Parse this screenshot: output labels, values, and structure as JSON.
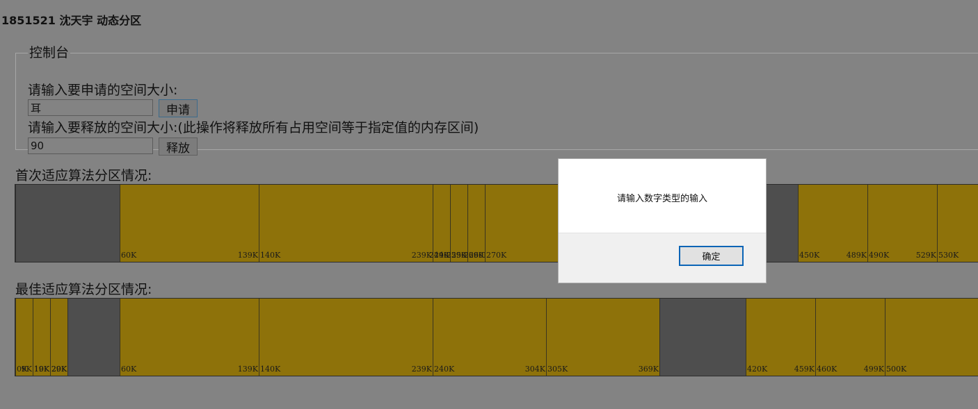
{
  "page": {
    "title": "1851521 沈天宇 动态分区"
  },
  "console": {
    "legend": "控制台",
    "apply_label": "请输入要申请的空间大小:",
    "apply_value": "耳",
    "apply_button": "申请",
    "release_label": "请输入要释放的空间大小:(此操作将释放所有占用空间等于指定值的内存区间)",
    "release_value": "90",
    "release_button": "释放"
  },
  "first_fit": {
    "title": "首次适应算法分区情况:",
    "blocks": [
      {
        "status": "free",
        "start": "",
        "end": ""
      },
      {
        "status": "used",
        "start": "60K",
        "end": "139K"
      },
      {
        "status": "used",
        "start": "140K",
        "end": "239K"
      },
      {
        "status": "used",
        "start": "240K",
        "end": "249K"
      },
      {
        "status": "used",
        "start": "250K",
        "end": "259K"
      },
      {
        "status": "used",
        "start": "260K",
        "end": "269K"
      },
      {
        "status": "used",
        "start": "270K",
        "end": ""
      },
      {
        "status": "free",
        "start": "",
        "end": ""
      },
      {
        "status": "used",
        "start": "450K",
        "end": "489K"
      },
      {
        "status": "used",
        "start": "490K",
        "end": "529K"
      },
      {
        "status": "used",
        "start": "530K",
        "end": ""
      }
    ]
  },
  "best_fit": {
    "title": "最佳适应算法分区情况:",
    "blocks": [
      {
        "status": "used",
        "start": "0K",
        "end": "9K"
      },
      {
        "status": "used",
        "start": "10K",
        "end": "19K"
      },
      {
        "status": "used",
        "start": "20K",
        "end": "29K"
      },
      {
        "status": "free",
        "start": "",
        "end": ""
      },
      {
        "status": "used",
        "start": "60K",
        "end": "139K"
      },
      {
        "status": "used",
        "start": "140K",
        "end": "239K"
      },
      {
        "status": "used",
        "start": "240K",
        "end": "304K"
      },
      {
        "status": "used",
        "start": "305K",
        "end": "369K"
      },
      {
        "status": "free",
        "start": "",
        "end": ""
      },
      {
        "status": "used",
        "start": "420K",
        "end": "459K"
      },
      {
        "status": "used",
        "start": "460K",
        "end": "499K"
      },
      {
        "status": "used",
        "start": "500K",
        "end": ""
      }
    ]
  },
  "dialog": {
    "message": "请输入数字类型的输入",
    "ok_button": "确定"
  },
  "colors": {
    "background": "#838383",
    "used_block": "#8e720a",
    "free_block": "#4e4e4e",
    "dialog_button_border": "#0a64b6"
  }
}
